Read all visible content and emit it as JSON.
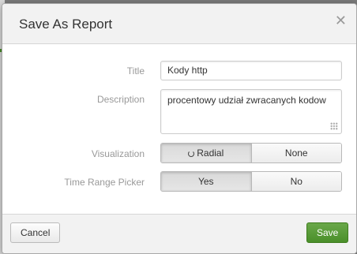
{
  "dialog": {
    "title": "Save As Report",
    "close_icon": "close-icon"
  },
  "form": {
    "title_label": "Title",
    "title_value": "Kody http",
    "description_label": "Description",
    "description_value": "procentowy udział zwracanych kodow",
    "visualization_label": "Visualization",
    "visualization_options": [
      "Radial",
      "None"
    ],
    "visualization_selected": "Radial",
    "visualization_icon": "radial-gauge-icon",
    "time_range_label": "Time Range Picker",
    "time_range_options": [
      "Yes",
      "No"
    ],
    "time_range_selected": "Yes"
  },
  "footer": {
    "cancel_label": "Cancel",
    "save_label": "Save"
  },
  "colors": {
    "save_button": "#4a8f2a",
    "header_bg": "#f2f2f2",
    "label": "#999999"
  }
}
